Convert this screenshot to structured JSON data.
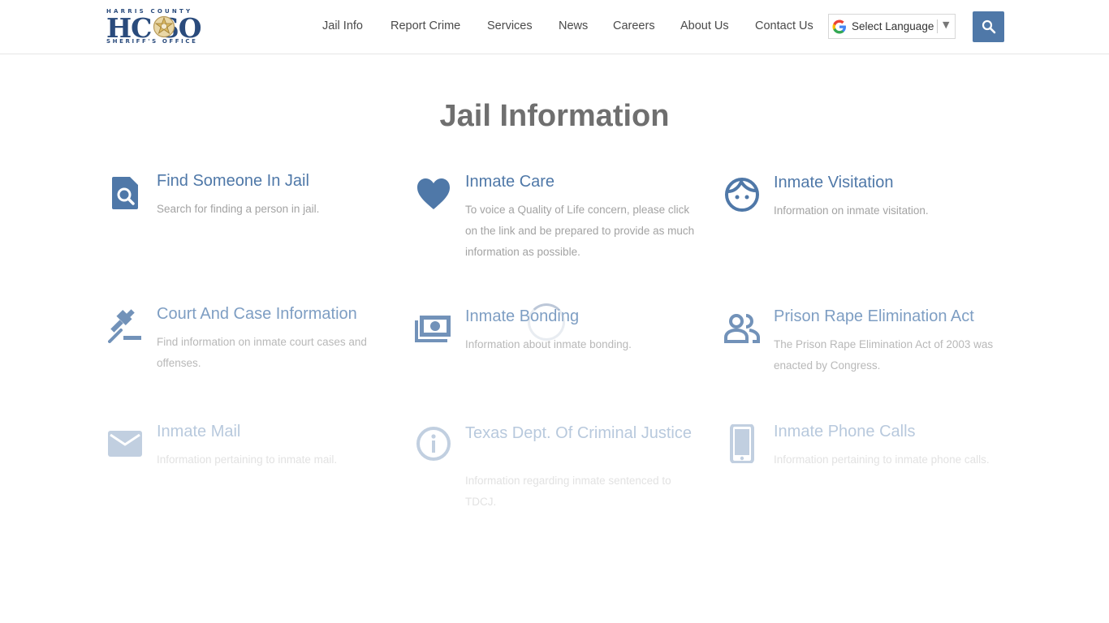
{
  "logo": {
    "top_text": "HARRIS COUNTY",
    "letters": "HC SO",
    "bottom_text": "SHERIFF'S OFFICE"
  },
  "nav": [
    {
      "label": "Jail Info"
    },
    {
      "label": "Report Crime"
    },
    {
      "label": "Services"
    },
    {
      "label": "News"
    },
    {
      "label": "Careers"
    },
    {
      "label": "About Us"
    },
    {
      "label": "Contact Us"
    }
  ],
  "language": {
    "label": "Select Language"
  },
  "page": {
    "title": "Jail Information"
  },
  "cards": [
    {
      "title": "Find Someone In Jail",
      "desc": "Search for finding a person in jail.",
      "icon": "search-document-icon"
    },
    {
      "title": "Inmate Care",
      "desc": "To voice a Quality of Life concern, please click on the link and be prepared to provide as much information as possible.",
      "icon": "heart-icon"
    },
    {
      "title": "Inmate Visitation",
      "desc": "Information on inmate visitation.",
      "icon": "face-icon"
    },
    {
      "title": "Court And Case Information",
      "desc": "Find information on inmate court cases and offenses.",
      "icon": "gavel-icon"
    },
    {
      "title": "Inmate Bonding",
      "desc": "Information about inmate bonding.",
      "icon": "money-icon"
    },
    {
      "title": "Prison Rape Elimination Act",
      "desc": "The Prison Rape Elimination Act of 2003 was enacted by Congress.",
      "icon": "people-icon"
    },
    {
      "title": "Inmate Mail",
      "desc": "Information pertaining to inmate mail.",
      "icon": "mail-icon"
    },
    {
      "title": "Texas Dept. Of Criminal Justice",
      "desc": "Information regarding inmate sentenced to TDCJ.",
      "icon": "info-icon"
    },
    {
      "title": "Inmate Phone Calls",
      "desc": "Information pertaining to inmate phone calls.",
      "icon": "phone-icon"
    }
  ],
  "colors": {
    "accent": "#4f78a8",
    "title": "#6f6f6f",
    "text": "#a3a3a3"
  }
}
